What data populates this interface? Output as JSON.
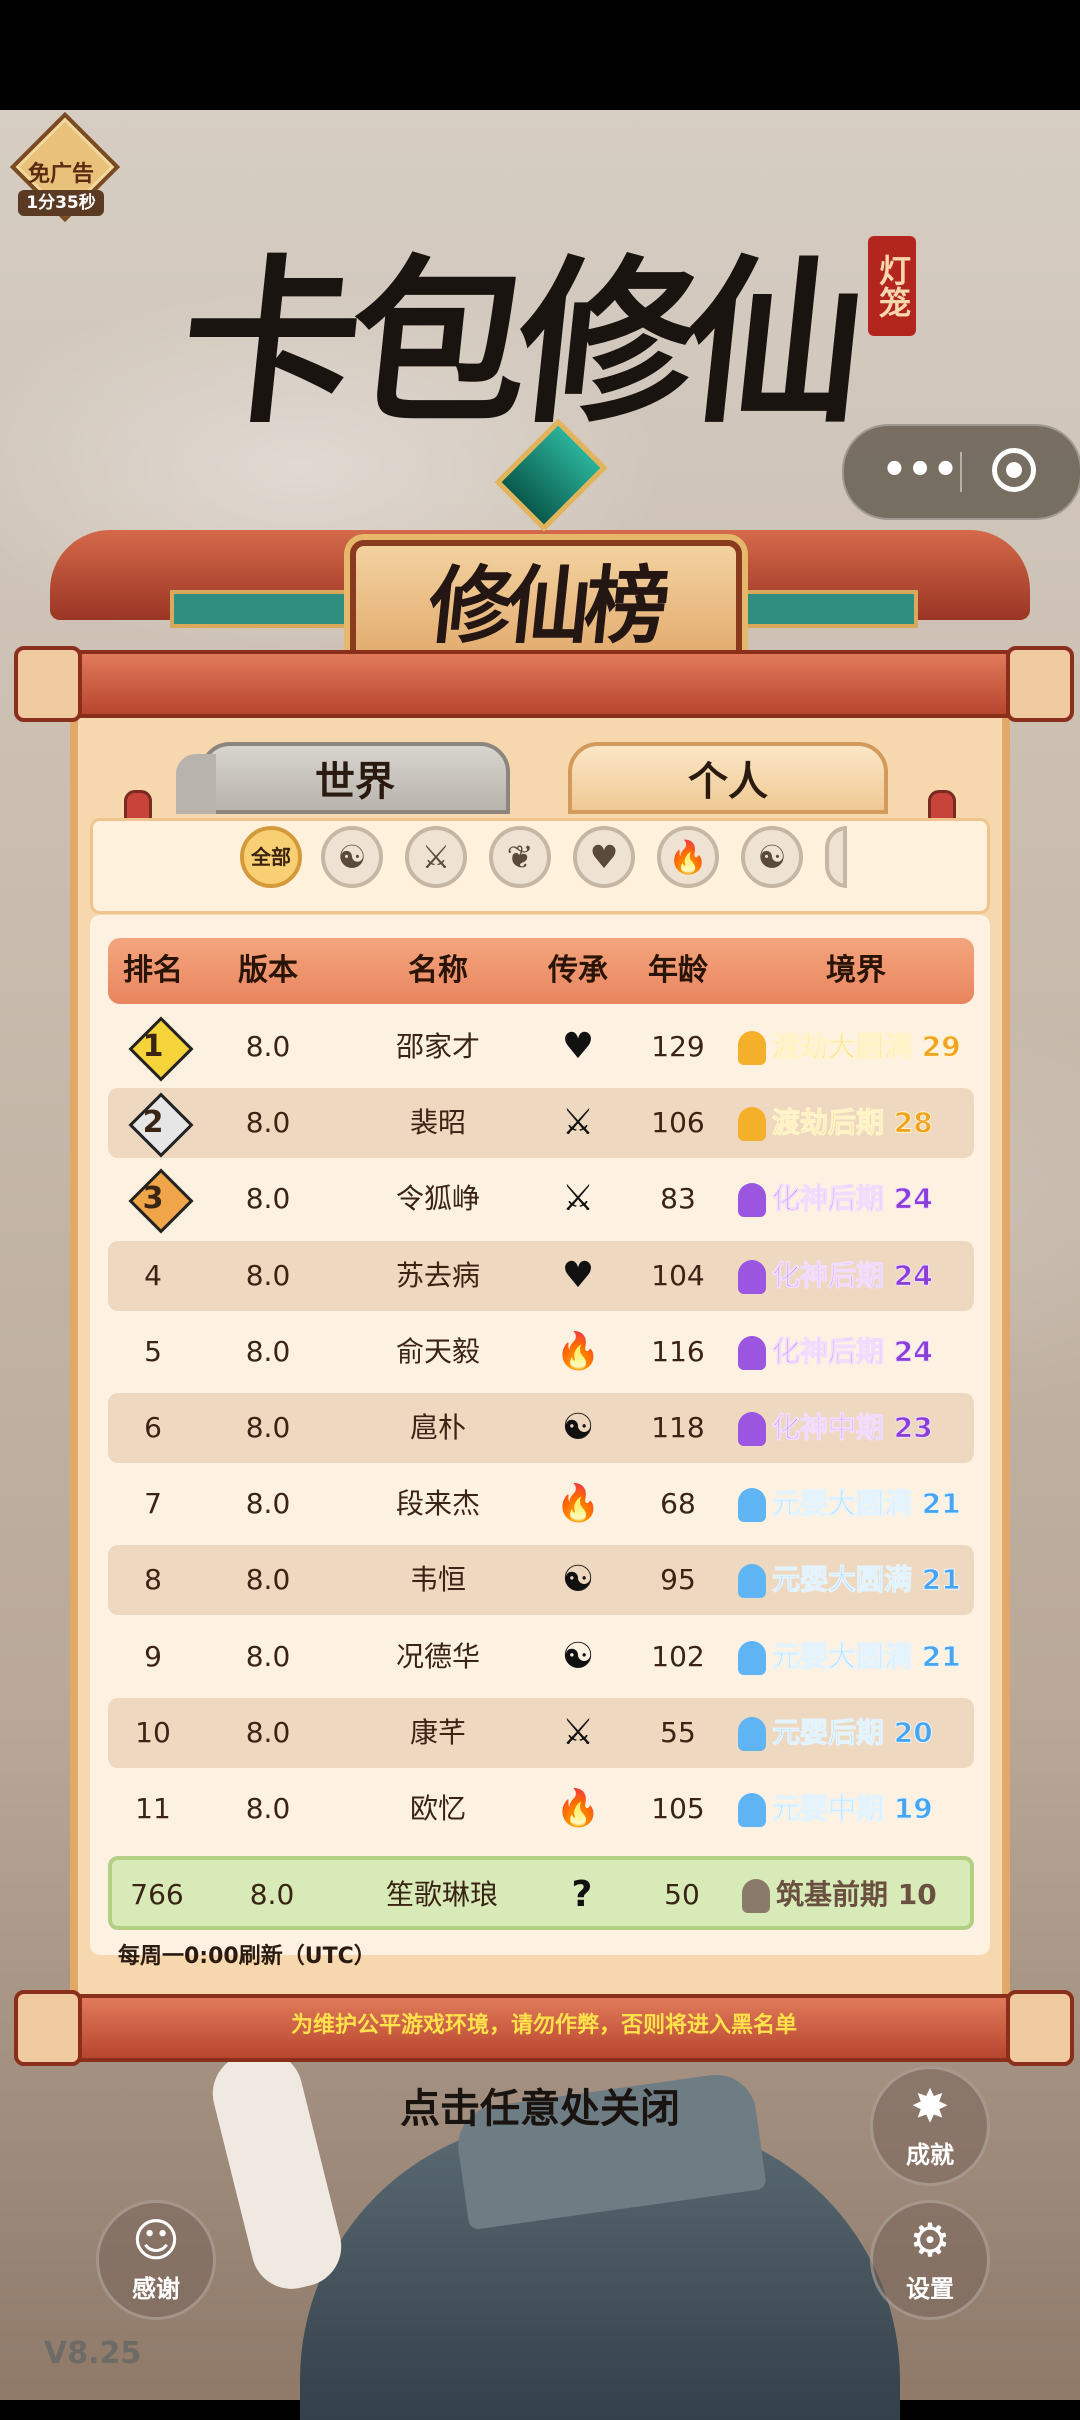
{
  "noads": {
    "label": "免广告",
    "timer": "1分35秒"
  },
  "title": {
    "game": "卡包修仙",
    "seal": "灯笼",
    "board": "修仙榜"
  },
  "tabs": {
    "world": "世界",
    "personal": "个人"
  },
  "filters": {
    "all": "全部",
    "icons": [
      "☯",
      "⚔",
      "❦",
      "♥",
      "🔥",
      "☯",
      "⚔"
    ]
  },
  "columns": {
    "rank": "排名",
    "version": "版本",
    "name": "名称",
    "inheritance": "传承",
    "age": "年龄",
    "realm": "境界"
  },
  "rows": [
    {
      "rank": "1",
      "version": "8.0",
      "name": "邵家才",
      "inheritance": "♥",
      "age": "129",
      "realm": "渡劫大圆满 29",
      "tier": "gold",
      "medal": "#f7d33a"
    },
    {
      "rank": "2",
      "version": "8.0",
      "name": "裴昭",
      "inheritance": "⚔",
      "age": "106",
      "realm": "渡劫后期 28",
      "tier": "gold",
      "medal": "#e6e6e6"
    },
    {
      "rank": "3",
      "version": "8.0",
      "name": "令狐峥",
      "inheritance": "⚔",
      "age": "83",
      "realm": "化神后期 24",
      "tier": "purple",
      "medal": "#f0a54a"
    },
    {
      "rank": "4",
      "version": "8.0",
      "name": "苏去病",
      "inheritance": "♥",
      "age": "104",
      "realm": "化神后期 24",
      "tier": "purple"
    },
    {
      "rank": "5",
      "version": "8.0",
      "name": "俞天毅",
      "inheritance": "🔥",
      "age": "116",
      "realm": "化神后期 24",
      "tier": "purple"
    },
    {
      "rank": "6",
      "version": "8.0",
      "name": "扈朴",
      "inheritance": "☯",
      "age": "118",
      "realm": "化神中期 23",
      "tier": "purple"
    },
    {
      "rank": "7",
      "version": "8.0",
      "name": "段来杰",
      "inheritance": "🔥",
      "age": "68",
      "realm": "元婴大圆满 21",
      "tier": "blue"
    },
    {
      "rank": "8",
      "version": "8.0",
      "name": "韦恒",
      "inheritance": "☯",
      "age": "95",
      "realm": "元婴大圆满 21",
      "tier": "blue"
    },
    {
      "rank": "9",
      "version": "8.0",
      "name": "况德华",
      "inheritance": "☯",
      "age": "102",
      "realm": "元婴大圆满 21",
      "tier": "blue"
    },
    {
      "rank": "10",
      "version": "8.0",
      "name": "康芊",
      "inheritance": "⚔",
      "age": "55",
      "realm": "元婴后期 20",
      "tier": "blue"
    },
    {
      "rank": "11",
      "version": "8.0",
      "name": "欧忆",
      "inheritance": "🔥",
      "age": "105",
      "realm": "元婴中期 19",
      "tier": "blue"
    }
  ],
  "me": {
    "rank": "766",
    "version": "8.0",
    "name": "笙歌琳琅",
    "inheritance": "?",
    "age": "50",
    "realm": "筑基前期 10"
  },
  "refresh_note": "每周一0:00刷新（UTC）",
  "warning": "为维护公平游戏环境，请勿作弊，否则将进入黑名单",
  "close_hint": "点击任意处关闭",
  "buttons": {
    "achievement": "成就",
    "thanks": "感谢",
    "settings": "设置"
  },
  "version": "V8.25",
  "colors": {
    "gold": "#f1a21f",
    "purple": "#8a3fd8",
    "blue": "#46a4f0",
    "me_row": "#d8eab8"
  }
}
